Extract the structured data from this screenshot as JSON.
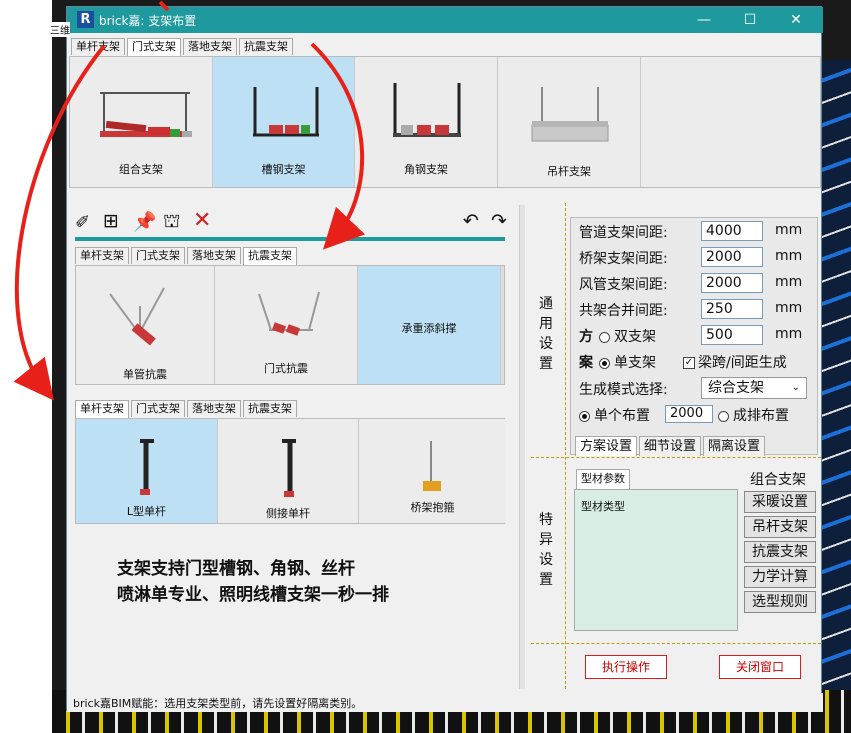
{
  "window": {
    "title": "brick嘉: 支架布置",
    "logo": "R",
    "min": "—",
    "max": "☐",
    "close": "✕"
  },
  "bg_text": "三维",
  "top_tabs": [
    "单杆支架",
    "门式支架",
    "落地支架",
    "抗震支架"
  ],
  "top_cards": [
    "组合支架",
    "槽钢支架",
    "角钢支架",
    "吊杆支架"
  ],
  "toolbar_icons": [
    "brush-icon",
    "add-box-icon",
    "pin-icon",
    "hanger-icon",
    "delete-icon",
    "undo-icon",
    "redo-icon"
  ],
  "mid_tabs": [
    "单杆支架",
    "门式支架",
    "落地支架",
    "抗震支架"
  ],
  "mid_cards": [
    "单管抗震",
    "门式抗震",
    "承重添斜撑"
  ],
  "low_tabs": [
    "单杆支架",
    "门式支架",
    "落地支架",
    "抗震支架"
  ],
  "low_cards": [
    "L型单杆",
    "侧接单杆",
    "桥架抱箍"
  ],
  "promo": [
    "支架支持门型槽钢、角钢、丝杆",
    "喷淋单专业、照明线槽支架一秒一排"
  ],
  "status": "brick嘉BIM赋能：选用支架类型前，请先设置好隔离类别。",
  "general": {
    "label": [
      "通",
      "用",
      "设",
      "置"
    ],
    "pipe_spacing": {
      "label": "管道支架间距:",
      "value": "4000",
      "unit": "mm"
    },
    "tray_spacing": {
      "label": "桥架支架间距:",
      "value": "2000",
      "unit": "mm"
    },
    "duct_spacing": {
      "label": "风管支架间距:",
      "value": "2000",
      "unit": "mm"
    },
    "merge_spacing": {
      "label": "共架合并间距:",
      "value": "250",
      "unit": "mm"
    },
    "scheme_label": [
      "方",
      "案"
    ],
    "double_label": "双支架",
    "double_value": "500",
    "double_unit": "mm",
    "single_label": "单支架",
    "beam_check": "梁跨/间距生成",
    "mode_label": "生成模式选择:",
    "mode_value": "综合支架",
    "single_layout": "单个布置",
    "single_layout_value": "2000",
    "row_layout": "成排布置",
    "subtabs": [
      "方案设置",
      "细节设置",
      "隔离设置"
    ]
  },
  "special": {
    "label": [
      "特",
      "异",
      "设",
      "置"
    ],
    "tab": "型材参数",
    "type_label": "型材类型",
    "buttons": [
      "组合支架",
      "采暖设置",
      "吊杆支架",
      "抗震支架",
      "力学计算",
      "选型规则"
    ]
  },
  "actions": {
    "execute": "执行操作",
    "close": "关闭窗口"
  },
  "colors": {
    "title_bar": "#1e9a9e",
    "accent": "#d02020",
    "selection": "#bde0f5"
  }
}
